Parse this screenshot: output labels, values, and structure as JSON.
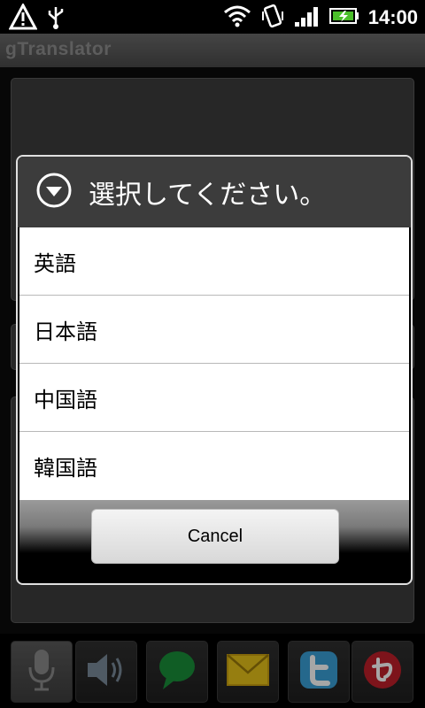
{
  "status_bar": {
    "time": "14:00",
    "icons": [
      "warning-icon",
      "usb-icon",
      "wifi-icon",
      "vibrate-icon",
      "signal-icon",
      "battery-icon"
    ]
  },
  "app": {
    "title": "gTranslator"
  },
  "dialog": {
    "title": "選択してください。",
    "options": [
      "英語",
      "日本語",
      "中国語",
      "韓国語"
    ],
    "cancel_label": "Cancel"
  },
  "toolbar": {
    "buttons": [
      "microphone-icon",
      "speaker-icon",
      "chat-bubble-icon",
      "mail-icon",
      "twitter-icon",
      "app-logo-icon"
    ]
  },
  "colors": {
    "dialog_header": "#3c3c3c",
    "list_background": "#ffffff",
    "chat_green": "#1a8f3a",
    "mail_yellow": "#e6c21a",
    "twitter_blue": "#3aa0d8",
    "logo_red": "#c0202a"
  }
}
